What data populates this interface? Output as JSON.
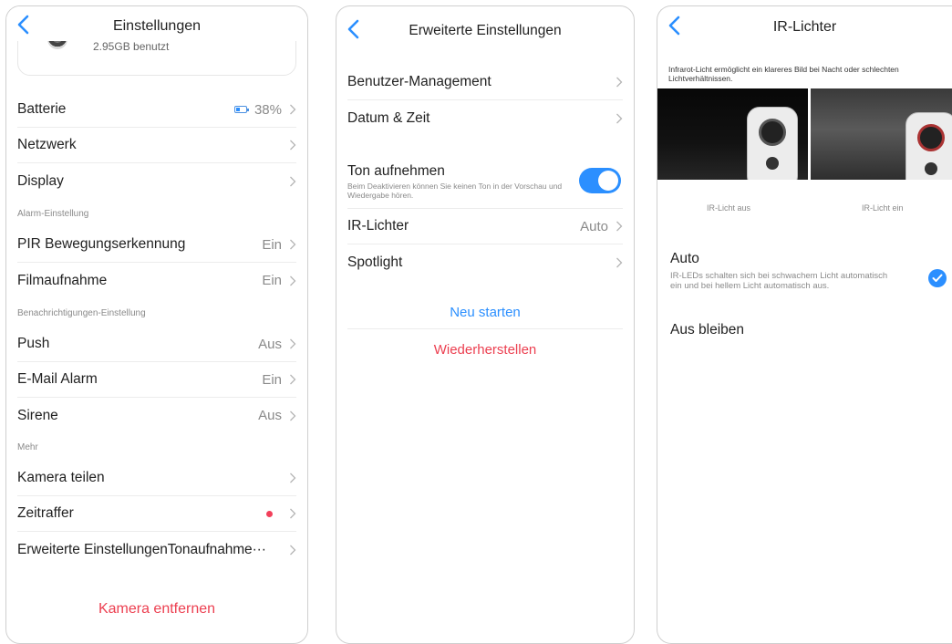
{
  "colors": {
    "accent": "#2b8fff",
    "danger": "#ec3f50",
    "muted": "#8a8a8a",
    "recording_dot": "#f2405a"
  },
  "icons": {
    "back": "chevron-left-icon",
    "row_arrow": "chevron-right-icon",
    "battery": "battery-icon",
    "check": "checkmark-icon"
  },
  "screen1": {
    "title": "Einstellungen",
    "storage": {
      "used": "2.95GB benutzt"
    },
    "rows": {
      "battery": {
        "label": "Batterie",
        "value": "38%",
        "level_percent": 38
      },
      "network": {
        "label": "Netzwerk"
      },
      "display": {
        "label": "Display"
      },
      "pir": {
        "label": "PIR Bewegungserkennung",
        "value": "Ein"
      },
      "recording": {
        "label": "Filmaufnahme",
        "value": "Ein"
      },
      "push": {
        "label": "Push",
        "value": "Aus"
      },
      "email": {
        "label": "E-Mail Alarm",
        "value": "Ein"
      },
      "siren": {
        "label": "Sirene",
        "value": "Aus"
      },
      "share": {
        "label": "Kamera teilen"
      },
      "timelapse": {
        "label": "Zeitraffer"
      },
      "advanced": {
        "label": "Erweiterte EinstellungenTonaufnahme···"
      }
    },
    "sections": {
      "alarm": "Alarm-Einstellung",
      "notifications": "Benachrichtigungen-Einstellung",
      "more": "Mehr"
    },
    "remove_label": "Kamera entfernen"
  },
  "screen2": {
    "title": "Erweiterte Einstellungen",
    "rows": {
      "users": {
        "label": "Benutzer-Management"
      },
      "datetime": {
        "label": "Datum & Zeit"
      },
      "sound": {
        "label": "Ton aufnehmen",
        "desc": "Beim Deaktivieren können Sie keinen Ton in der Vorschau und Wiedergabe hören.",
        "enabled": true
      },
      "ir": {
        "label": "IR-Lichter",
        "value": "Auto"
      },
      "spotlight": {
        "label": "Spotlight"
      }
    },
    "restart_label": "Neu starten",
    "restore_label": "Wiederherstellen"
  },
  "screen3": {
    "title": "IR-Lichter",
    "description": "Infrarot-Licht ermöglicht ein klareres Bild bei Nacht oder schlechten Lichtverhältnissen.",
    "image_off_caption": "IR-Licht aus",
    "image_on_caption": "IR-Licht ein",
    "options": {
      "auto": {
        "label": "Auto",
        "desc": "IR-LEDs schalten sich bei schwachem Licht automatisch ein und bei hellem Licht automatisch aus.",
        "selected": true
      },
      "off": {
        "label": "Aus bleiben",
        "selected": false
      }
    }
  }
}
